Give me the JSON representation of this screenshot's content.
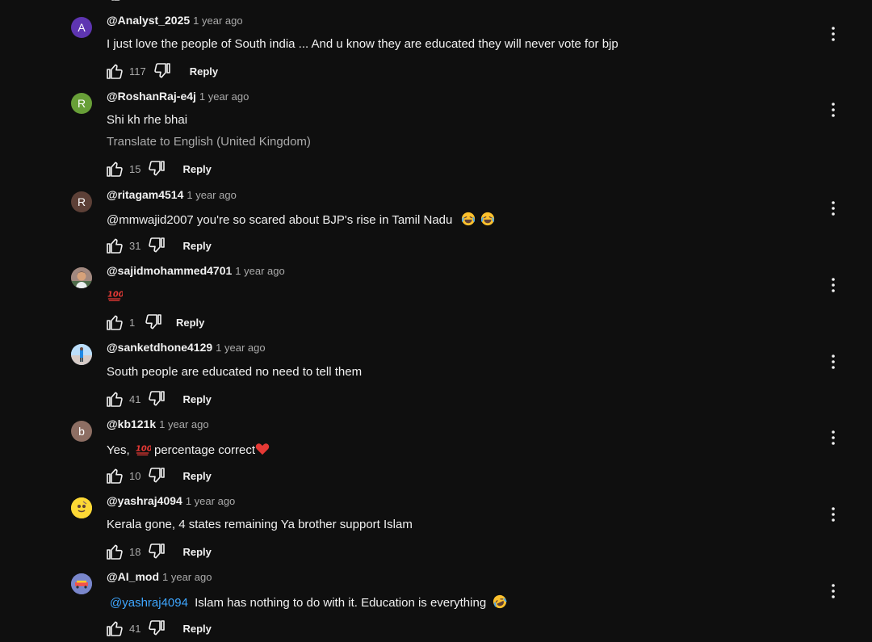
{
  "comments": [
    {
      "author": "@Analyst_2025",
      "time": "1 year ago",
      "avatar_letter": "A",
      "avatar_color": "#5e35b1",
      "text": "I just love the people of South india ... And u know they are educated they will never vote for bjp",
      "likes": "117",
      "reply_label": "Reply"
    },
    {
      "author": "@RoshanRaj-e4j",
      "time": "1 year ago",
      "avatar_letter": "R",
      "avatar_color": "#689f38",
      "text": "Shi kh rhe bhai",
      "translate": "Translate to English (United Kingdom)",
      "likes": "15",
      "reply_label": "Reply"
    },
    {
      "author": "@ritagam4514",
      "time": "1 year ago",
      "avatar_letter": "R",
      "avatar_color": "#5d4037",
      "text": "@mmwajid2007 you're so scared about BJP's rise in Tamil Nadu",
      "likes": "31",
      "reply_label": "Reply"
    },
    {
      "author": "@sajidmohammed4701",
      "time": "1 year ago",
      "avatar_letter": "",
      "avatar_color": "#8d6e63",
      "text": "",
      "likes": "1",
      "reply_label": "Reply"
    },
    {
      "author": "@sanketdhone4129",
      "time": "1 year ago",
      "avatar_letter": "",
      "avatar_color": "#90caf9",
      "text": "South people are educated no need to tell them",
      "likes": "41",
      "reply_label": "Reply"
    },
    {
      "author": "@kb121k",
      "time": "1 year ago",
      "avatar_letter": "b",
      "avatar_color": "#8d6e63",
      "text_before": "Yes,",
      "text_after": "percentage correct",
      "likes": "10",
      "reply_label": "Reply"
    },
    {
      "author": "@yashraj4094",
      "time": "1 year ago",
      "avatar_letter": "",
      "avatar_color": "#fdd835",
      "text": "Kerala gone, 4 states remaining Ya brother support Islam",
      "likes": "18",
      "reply_label": "Reply"
    },
    {
      "author": "@AI_mod",
      "time": "1 year ago",
      "avatar_letter": "",
      "avatar_color": "#5c6bc0",
      "mention": "@yashraj4094",
      "text": "Islam has nothing to do with it. Education is everything",
      "likes": "41",
      "reply_label": "Reply"
    }
  ],
  "icons": {
    "like": "thumbs-up-icon",
    "dislike": "thumbs-down-icon",
    "menu": "more-vertical-icon",
    "laughing": "laughing-emoji-icon",
    "hundred": "hundred-points-emoji-icon",
    "heart": "red-heart-emoji-icon",
    "rofl": "rolling-laughing-emoji-icon"
  },
  "colors": {
    "background": "#0f0f0f",
    "text": "#f1f1f1",
    "secondary": "#aaaaaa",
    "link": "#3ea6ff"
  }
}
